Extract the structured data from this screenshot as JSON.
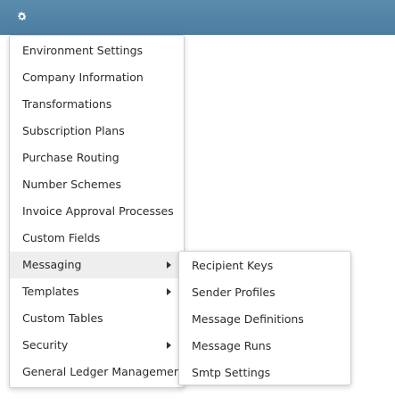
{
  "toolbar": {
    "gear_icon": "gear-icon",
    "bar_color": "#4f82a5"
  },
  "main_menu": {
    "items": [
      {
        "label": "Environment Settings"
      },
      {
        "label": "Company Information"
      },
      {
        "label": "Transformations"
      },
      {
        "label": "Subscription Plans"
      },
      {
        "label": "Purchase Routing"
      },
      {
        "label": "Number Schemes"
      },
      {
        "label": "Invoice Approval Processes"
      },
      {
        "label": "Custom Fields"
      },
      {
        "label": "Messaging",
        "has_submenu": true,
        "active": true
      },
      {
        "label": "Templates",
        "has_submenu": true
      },
      {
        "label": "Custom Tables"
      },
      {
        "label": "Security",
        "has_submenu": true
      },
      {
        "label": "General Ledger Management"
      }
    ]
  },
  "sub_menu": {
    "items": [
      {
        "label": "Recipient Keys"
      },
      {
        "label": "Sender Profiles"
      },
      {
        "label": "Message Definitions"
      },
      {
        "label": "Message Runs"
      },
      {
        "label": "Smtp Settings"
      }
    ]
  }
}
